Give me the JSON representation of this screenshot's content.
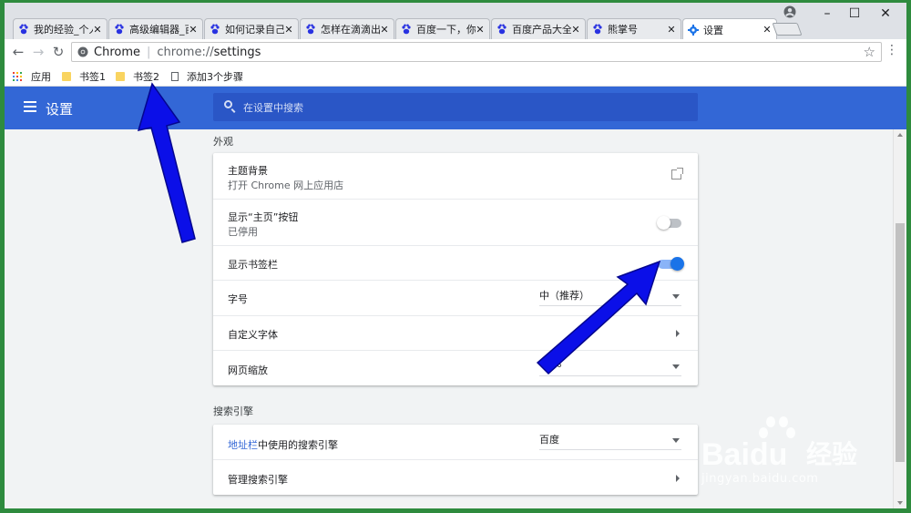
{
  "colors": {
    "header_blue": "#3367d6",
    "search_blue": "#2a56c6",
    "toggle_on": "#1a73e8",
    "arrow_blue": "#0b0fe8",
    "frame_green": "#2e8b3e"
  },
  "tabs": [
    {
      "title": "我的经验_个人",
      "icon": "baidu-paw-icon",
      "active": false
    },
    {
      "title": "高级编辑器_百",
      "icon": "baidu-paw-icon",
      "active": false
    },
    {
      "title": "如何记录自己",
      "icon": "baidu-paw-icon",
      "active": false
    },
    {
      "title": "怎样在滴滴出",
      "icon": "baidu-paw-icon",
      "active": false
    },
    {
      "title": "百度一下，你",
      "icon": "baidu-paw-icon",
      "active": false
    },
    {
      "title": "百度产品大全",
      "icon": "baidu-paw-icon",
      "active": false
    },
    {
      "title": "熊掌号",
      "icon": "baidu-paw-icon",
      "active": false
    },
    {
      "title": "设置",
      "icon": "gear-icon",
      "active": true
    }
  ],
  "window_controls": {
    "minimize": "–",
    "maximize": "☐",
    "close": "✕"
  },
  "toolbar": {
    "back": "←",
    "forward": "→",
    "reload": "↻",
    "site_name": "Chrome",
    "url_scheme": "chrome://",
    "url_path": "settings",
    "star": "☆",
    "menu": "⋮"
  },
  "bookmarks": [
    {
      "label": "应用",
      "icon": "apps-grid-icon"
    },
    {
      "label": "书签1",
      "icon": "folder-icon"
    },
    {
      "label": "书签2",
      "icon": "folder-icon"
    },
    {
      "label": "添加3个步骤",
      "icon": "page-icon"
    }
  ],
  "header": {
    "title": "设置",
    "search_placeholder": "在设置中搜索"
  },
  "appearance": {
    "section_title": "外观",
    "theme": {
      "primary": "主题背景",
      "secondary": "打开 Chrome 网上应用店"
    },
    "home_button": {
      "primary": "显示“主页”按钮",
      "secondary": "已停用",
      "enabled": false
    },
    "bookmarks_bar": {
      "primary": "显示书签栏",
      "enabled": true
    },
    "font_size": {
      "primary": "字号",
      "value": "中（推荐）"
    },
    "custom_fonts": {
      "primary": "自定义字体"
    },
    "page_zoom": {
      "primary": "网页缩放",
      "value": "%"
    }
  },
  "search_engine": {
    "section_title": "搜索引擎",
    "address_bar": {
      "link_word": "地址栏",
      "primary_rest": "中使用的搜索引擎",
      "value": "百度"
    },
    "manage": {
      "primary": "管理搜索引擎"
    }
  },
  "watermark": {
    "brand": "Baidu",
    "suffix": "经验",
    "url": "jingyan.baidu.com"
  }
}
